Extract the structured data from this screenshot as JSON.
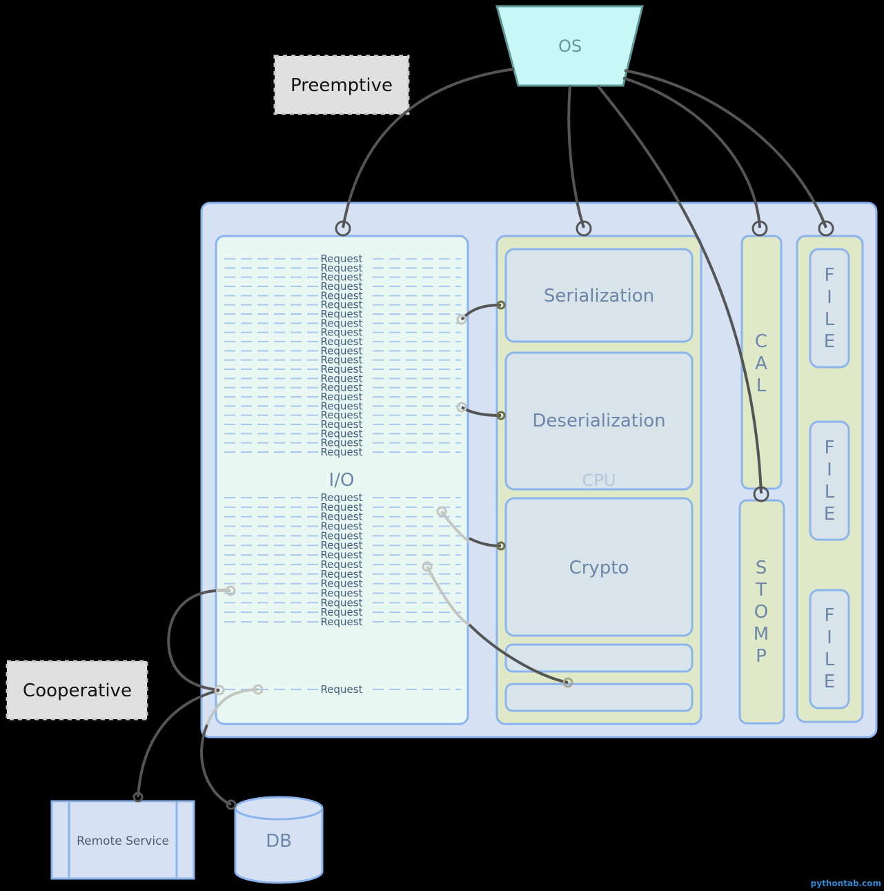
{
  "os": {
    "label": "OS"
  },
  "notes": {
    "preemptive": "Preemptive",
    "cooperative": "Cooperative"
  },
  "io": {
    "label": "I/O",
    "request_label": "Request",
    "upper_request_count": 22,
    "lower_request_count": 14,
    "bottom_request_count": 1
  },
  "cpu": {
    "label": "CPU",
    "blocks": [
      "Serialization",
      "Deserialization",
      "Crypto",
      "",
      ""
    ]
  },
  "cal": {
    "label": "CAL",
    "letters": [
      "C",
      "A",
      "L"
    ]
  },
  "stomp": {
    "label": "STOMP",
    "letters": [
      "S",
      "T",
      "O",
      "M",
      "P"
    ]
  },
  "files": [
    {
      "label": "FILE",
      "letters": [
        "F",
        "I",
        "L",
        "E"
      ]
    },
    {
      "label": "FILE",
      "letters": [
        "F",
        "I",
        "L",
        "E"
      ]
    },
    {
      "label": "FILE",
      "letters": [
        "F",
        "I",
        "L",
        "E"
      ]
    }
  ],
  "remote_service": {
    "label": "Remote Service"
  },
  "db": {
    "label": "DB"
  },
  "watermark": "pythontab.com",
  "colors": {
    "os_fill": "#c8f8f6",
    "os_stroke": "#5f9a98",
    "container_fill": "#d6e2f3",
    "border_blue": "#8bb4ee",
    "io_fill": "#e8f7f2",
    "cpu_fill": "#e0e9c7",
    "block_fill": "#d9e4ea",
    "note_fill": "#e0e0e0",
    "wire": "#555555",
    "wire_faded": "#c3c6c0"
  }
}
